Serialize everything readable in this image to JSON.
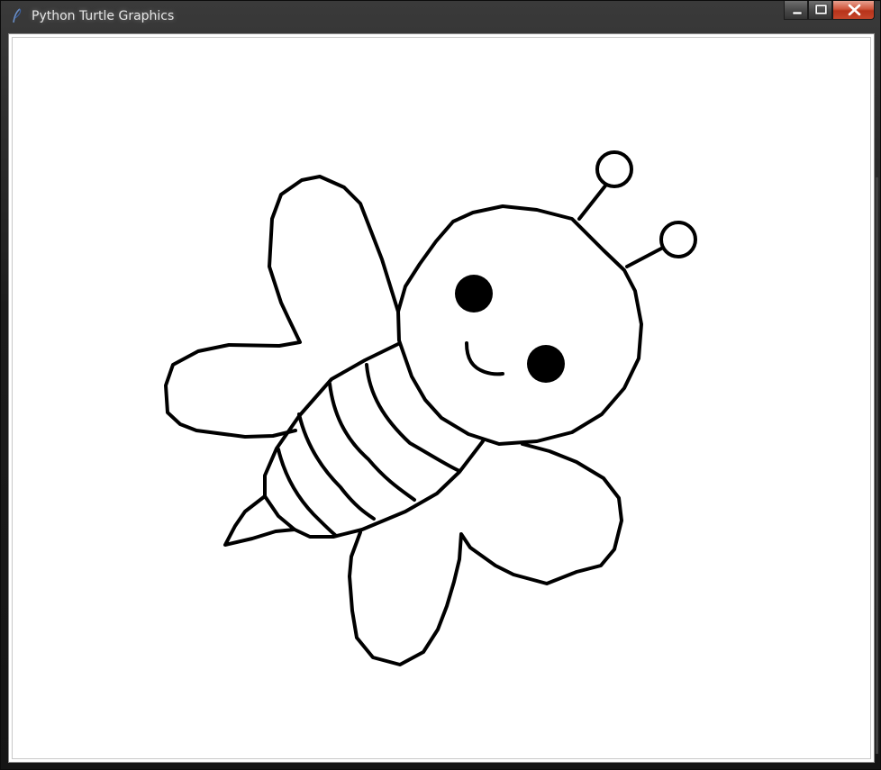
{
  "window": {
    "title": "Python Turtle Graphics",
    "icon": "turtle-feather-icon",
    "buttons": {
      "minimize": "minimize-icon",
      "maximize": "maximize-icon",
      "close": "close-icon"
    }
  },
  "canvas": {
    "background": "#ffffff",
    "drawing": "bee",
    "stroke_color": "#000000"
  }
}
